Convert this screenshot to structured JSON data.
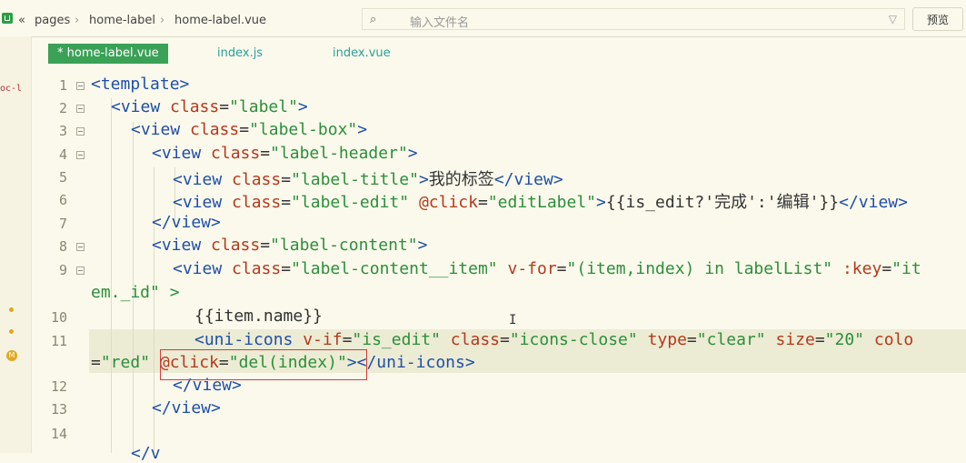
{
  "breadcrumb": {
    "nav": "«",
    "items": [
      "pages",
      "home-label",
      "home-label.vue"
    ]
  },
  "top_strip_text": "…",
  "search": {
    "placeholder": "输入文件名",
    "icon": "file-search-icon",
    "filter_icon": "filter-icon"
  },
  "preview_button": "预览",
  "tabs": [
    {
      "label": "* home-label.vue",
      "active": true
    },
    {
      "label": "index.js",
      "active": false
    },
    {
      "label": "index.vue",
      "active": false
    }
  ],
  "side_label": "oc-l",
  "colors": {
    "tab_active": "#3aa157",
    "highlight_box": "#d83b3b",
    "tag": "#1f4fa8",
    "attr": "#b5391c",
    "string": "#2b8f3a"
  },
  "line_numbers": [
    "1",
    "2",
    "3",
    "4",
    "5",
    "6",
    "7",
    "8",
    "9",
    "10",
    "11",
    "12",
    "13",
    "14"
  ],
  "code": {
    "l1": "<template>",
    "l2_a": "<view ",
    "l2_b": "class",
    "l2_c": "=",
    "l2_d": "\"label\"",
    "l2_e": ">",
    "l3_a": "<view ",
    "l3_b": "class",
    "l3_c": "=",
    "l3_d": "\"label-box\"",
    "l3_e": ">",
    "l4_a": "<view ",
    "l4_b": "class",
    "l4_c": "=",
    "l4_d": "\"label-header\"",
    "l4_e": ">",
    "l5_a": "<view ",
    "l5_b": "class",
    "l5_c": "=",
    "l5_d": "\"label-title\"",
    "l5_e": ">",
    "l5_f": "我的标签",
    "l5_g": "</view>",
    "l6_a": "<view ",
    "l6_b": "class",
    "l6_c": "=",
    "l6_d": "\"label-edit\"",
    "l6_e": " @click",
    "l6_f": "=",
    "l6_g": "\"editLabel\"",
    "l6_h": ">",
    "l6_i": "{{is_edit?'完成':'编辑'}}",
    "l6_j": "</view>",
    "l7": "</view>",
    "l8_a": "<view ",
    "l8_b": "class",
    "l8_c": "=",
    "l8_d": "\"label-content\"",
    "l8_e": ">",
    "l9_a": "<view ",
    "l9_b": "class",
    "l9_c": "=",
    "l9_d": "\"label-content__item\"",
    "l9_e": " v-for",
    "l9_f": "=",
    "l9_g": "\"(item,index) in labelList\"",
    "l9_h": " :key",
    "l9_i": "=",
    "l9_j": "\"it",
    "l9w": "em._id\" >",
    "l10": "{{item.name}}",
    "l11_a": "<uni-icons ",
    "l11_b": "v-if",
    "l11_c": "=",
    "l11_d": "\"is_edit\"",
    "l11_e": " class",
    "l11_f": "=",
    "l11_g": "\"icons-close\"",
    "l11_h": " type",
    "l11_i": "=",
    "l11_j": "\"clear\"",
    "l11_k": " size",
    "l11_l": "=",
    "l11_m": "\"20\"",
    "l11_n": " colo",
    "l11w_a": "=",
    "l11w_b": "\"red\"",
    "l11w_c": " @click",
    "l11w_d": "=",
    "l11w_e": "\"del(index)\"",
    "l11w_f": "></uni-icons>",
    "l12": "</view>",
    "l13": "</view>",
    "l15": "</v"
  }
}
